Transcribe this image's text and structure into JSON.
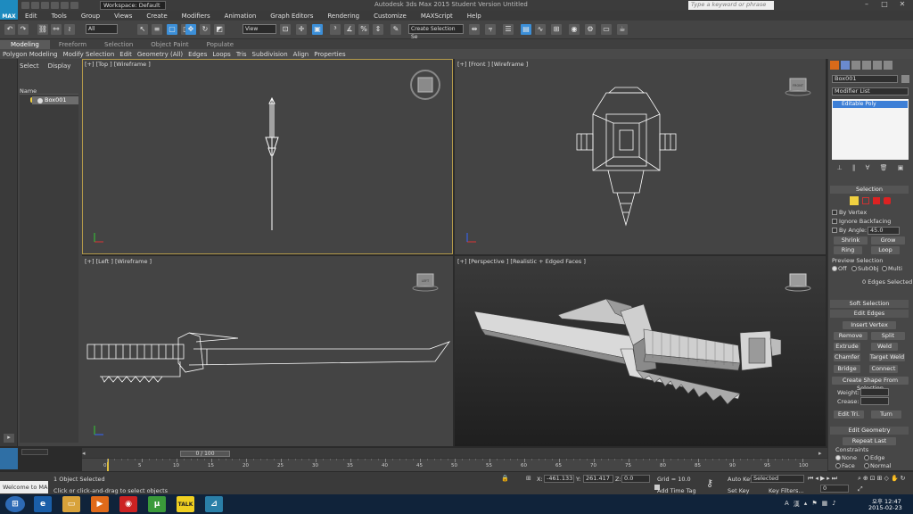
{
  "titlebar": {
    "logo": "MAX",
    "workspace": "Workspace: Default",
    "app_title": "Autodesk 3ds Max  2015     Student Version    Untitled",
    "search_placeholder": "Type a keyword or phrase",
    "min": "–",
    "max": "□",
    "close": "✕"
  },
  "menu": [
    "Edit",
    "Tools",
    "Group",
    "Views",
    "Create",
    "Modifiers",
    "Animation",
    "Graph Editors",
    "Rendering",
    "Customize",
    "MAXScript",
    "Help"
  ],
  "toolbar": {
    "filter_dropdown": "All",
    "refcoord_dropdown": "View",
    "named_selection": "Create Selection Se"
  },
  "ribbon": {
    "tabs": [
      "Modeling",
      "Freeform",
      "Selection",
      "Object Paint",
      "Populate"
    ],
    "active_tab": "Modeling",
    "groups": [
      "Polygon Modeling",
      "Modify Selection",
      "Edit",
      "Geometry (All)",
      "Edges",
      "Loops",
      "Tris",
      "Subdivision",
      "Align",
      "Properties"
    ]
  },
  "explorer": {
    "tabs": [
      "Select",
      "Display"
    ],
    "column_name": "Name",
    "items": [
      "Box001"
    ]
  },
  "viewports": [
    {
      "label": "[+] [Top ] [Wireframe ]"
    },
    {
      "label": "[+] [Front ] [Wireframe ]"
    },
    {
      "label": "[+] [Left ] [Wireframe ]"
    },
    {
      "label": "[+] [Perspective ] [Realistic + Edged Faces ]"
    }
  ],
  "viewcube": {
    "front": "FRONT",
    "left": "LEFT"
  },
  "command_panel": {
    "object_name": "Box001",
    "modifier_list": "Modifier List",
    "stack_item": "Editable Poly",
    "selection_rollout": "Selection",
    "by_vertex": "By Vertex",
    "ignore_backfacing": "Ignore Backfacing",
    "by_angle": "By Angle:",
    "by_angle_value": "45.0",
    "shrink": "Shrink",
    "grow": "Grow",
    "ring": "Ring",
    "loop": "Loop",
    "preview_selection": "Preview Selection",
    "preview_off": "Off",
    "preview_subobj": "SubObj",
    "preview_multi": "Multi",
    "edges_selected": "0 Edges Selected",
    "soft_selection": "Soft Selection",
    "edit_edges": "Edit Edges",
    "insert_vertex": "Insert Vertex",
    "remove": "Remove",
    "split": "Split",
    "extrude": "Extrude",
    "weld": "Weld",
    "chamfer": "Chamfer",
    "target_weld": "Target Weld",
    "bridge": "Bridge",
    "connect": "Connect",
    "create_shape": "Create Shape From Selection",
    "weight": "Weight:",
    "crease": "Crease:",
    "edit_tri": "Edit Tri.",
    "turn": "Turn",
    "edit_geometry": "Edit Geometry",
    "repeat_last": "Repeat Last",
    "constraints": "Constraints",
    "c_none": "None",
    "c_edge": "Edge",
    "c_face": "Face",
    "c_normal": "Normal"
  },
  "timeline": {
    "slider": "0 / 100",
    "ticks": [
      "0",
      "5",
      "10",
      "15",
      "20",
      "25",
      "30",
      "35",
      "40",
      "45",
      "50",
      "55",
      "60",
      "65",
      "70",
      "75",
      "80",
      "85",
      "90",
      "95",
      "100"
    ]
  },
  "status": {
    "maxscript": "Welcome to MA",
    "selected": "1 Object Selected",
    "prompt": "Click or click-and-drag to select objects",
    "x_label": "X:",
    "x_value": "-461.133",
    "y_label": "Y:",
    "y_value": "261.417",
    "z_label": "Z:",
    "z_value": "0.0",
    "grid": "Grid = 10.0",
    "add_time_tag": "Add Time Tag",
    "auto_key": "Auto Key",
    "set_key": "Set Key",
    "selected_dropdown": "Selected",
    "key_filters": "Key Filters...",
    "frame": "0"
  },
  "taskbar": {
    "time": "오후 12:47",
    "date": "2015-02-23"
  },
  "colors": {
    "accent": "#3c8fd8",
    "taskbar": "#10233a"
  }
}
